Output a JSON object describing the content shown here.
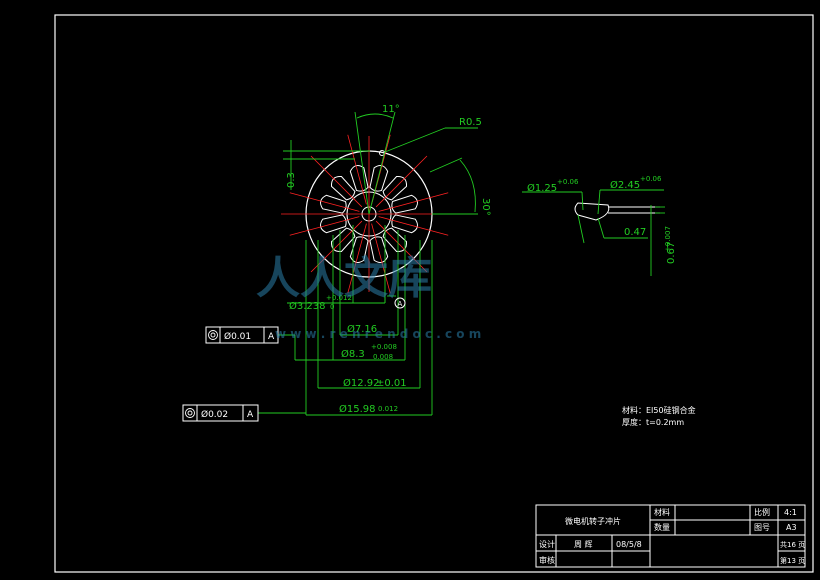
{
  "colors": {
    "background": "#000000",
    "border": "#ffffff",
    "outline": "#ffffff",
    "dimension": "#22cc22",
    "centerline": "#ff2222",
    "watermark": "#2a7ea8"
  },
  "dimensions": {
    "angle": "11°",
    "radius": "R0.5",
    "left_height": "0.3",
    "right_angle": "30°",
    "d1": "Ø3.238",
    "d1_tol_up": "+0.012",
    "d1_tol_lo": "0",
    "d2": "Ø7.16",
    "d3": "Ø8.3",
    "d3_tol_up": "+0.008",
    "d3_tol_lo": "0.008",
    "d4": "Ø12.92",
    "d4_tol": "±0.01",
    "d5": "Ø15.98",
    "d5_tol": "0.012"
  },
  "detail": {
    "d_small": "Ø1.25",
    "d_small_tol": "+0.06",
    "d_large": "Ø2.45",
    "d_large_tol": "+0.06",
    "width": "0.47",
    "height": "0.67",
    "height_tol": "+0.007"
  },
  "tolerance_frames": [
    {
      "value": "Ø0.01",
      "datum": "A"
    },
    {
      "value": "Ø0.02",
      "datum": "A"
    }
  ],
  "datum_label": "A",
  "notes": {
    "material": "材料：EI50硅钢合金",
    "thickness": "厚度：t=0.2mm"
  },
  "title_block": {
    "drawing_name": "微电机转子冲片",
    "material_label": "材料",
    "quantity_label": "数量",
    "scale_label": "比例",
    "scale_value": "4:1",
    "drawing_no_label": "图号",
    "drawing_no_value": "A3",
    "design_label": "设计",
    "designer": "周 辉",
    "date": "08/5/8",
    "review_label": "审核",
    "total_sheets": "共16 页",
    "sheet_no": "第13 页"
  },
  "watermark": {
    "text": "人人文库",
    "url": "w w w . r e n r e n d o c . c o m"
  }
}
